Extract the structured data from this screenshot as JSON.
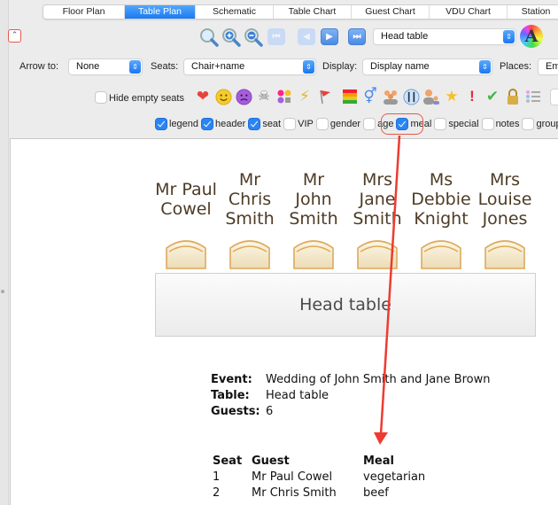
{
  "tabs": [
    {
      "label": "Floor Plan",
      "active": false
    },
    {
      "label": "Table Plan",
      "active": true
    },
    {
      "label": "Schematic",
      "active": false
    },
    {
      "label": "Table Chart",
      "active": false
    },
    {
      "label": "Guest Chart",
      "active": false
    },
    {
      "label": "VDU Chart",
      "active": false
    },
    {
      "label": "Station",
      "active": false
    }
  ],
  "toolbar": {
    "collapse_glyph": "⌃",
    "table_select": "Head table",
    "nav": [
      "first",
      "previous",
      "next",
      "last"
    ],
    "app_logo_letter": "A",
    "arrow_to": {
      "label": "Arrow to:",
      "value": "None"
    },
    "seats": {
      "label": "Seats:",
      "value": "Chair+name"
    },
    "display": {
      "label": "Display:",
      "value": "Display name"
    },
    "places": {
      "label": "Places:",
      "value": "Em"
    },
    "hide_empty_seats": {
      "label": "Hide empty seats",
      "checked": false
    },
    "symbol_icons": [
      "heart-icon",
      "happy-face-icon",
      "sad-face-icon",
      "skull-icon",
      "mixed-symbols-icon",
      "lightning-icon",
      "flag-icon",
      "color-bars-icon",
      "gender-icon",
      "group-icon",
      "meal-icon",
      "adult-child-icon",
      "star-icon",
      "exclamation-icon",
      "checkmark-icon",
      "lock-icon",
      "list-icon"
    ],
    "fields": [
      {
        "label": "legend",
        "checked": true
      },
      {
        "label": "header",
        "checked": true
      },
      {
        "label": "seat",
        "checked": true
      },
      {
        "label": "VIP",
        "checked": false
      },
      {
        "label": "gender",
        "checked": false
      },
      {
        "label": "age",
        "checked": false
      },
      {
        "label": "meal",
        "checked": true
      },
      {
        "label": "special",
        "checked": false
      },
      {
        "label": "notes",
        "checked": false
      },
      {
        "label": "group",
        "checked": false
      }
    ]
  },
  "plan": {
    "guests": [
      {
        "lines": [
          "Mr Paul",
          "Cowel"
        ]
      },
      {
        "lines": [
          "Mr",
          "Chris",
          "Smith"
        ]
      },
      {
        "lines": [
          "Mr",
          "John",
          "Smith"
        ]
      },
      {
        "lines": [
          "Mrs",
          "Jane",
          "Smith"
        ]
      },
      {
        "lines": [
          "Ms",
          "Debbie",
          "Knight"
        ]
      },
      {
        "lines": [
          "Mrs",
          "Louise",
          "Jones"
        ]
      }
    ],
    "table_name": "Head table"
  },
  "info": {
    "event_label": "Event:",
    "event_value": "Wedding of John Smith and Jane Brown",
    "table_label": "Table:",
    "table_value": "Head table",
    "guests_label": "Guests:",
    "guests_value": "6"
  },
  "seat_table": {
    "headers": [
      "Seat",
      "Guest",
      "Meal"
    ],
    "rows": [
      [
        "1",
        "Mr Paul Cowel",
        "vegetarian"
      ],
      [
        "2",
        "Mr Chris Smith",
        "beef"
      ]
    ]
  },
  "colors": {
    "accent": "#1b79f2",
    "annotation_red": "#e8574a",
    "chair_outline": "#dcaa5c",
    "guest_text": "#4d3b25"
  }
}
